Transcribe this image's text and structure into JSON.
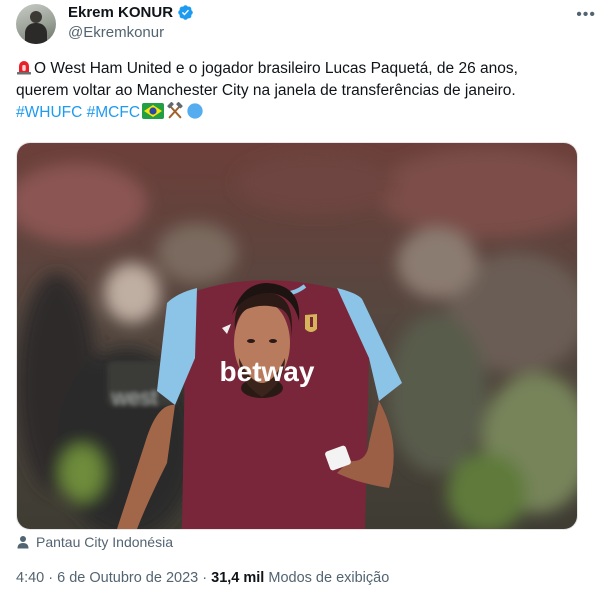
{
  "author": {
    "name": "Ekrem KONUR",
    "handle": "@Ekremkonur",
    "verified": true
  },
  "tweet": {
    "line1": "O West Ham United e o jogador brasileiro Lucas Paquetá, de 26 anos,",
    "line2": "querem voltar ao Manchester City na janela de transferências de janeiro.",
    "hashtags": [
      "#WHUFC",
      "#MCFC"
    ],
    "emojis": [
      "brazil-flag",
      "hammers",
      "blue-circle"
    ]
  },
  "media": {
    "shirt_sponsor": "betway"
  },
  "location": {
    "label": "Pantau City Indonésia",
    "icon": "person-icon"
  },
  "meta": {
    "time": "4:40",
    "separator": "·",
    "date": "6 de Outubro de 2023",
    "views_count": "31,4 mil",
    "views_label": "Modos de exibição"
  },
  "colors": {
    "link": "#1d9bf0",
    "secondary_text": "#536471",
    "west_ham_claret": "#7a263a",
    "west_ham_blue": "#8cc4e8"
  }
}
